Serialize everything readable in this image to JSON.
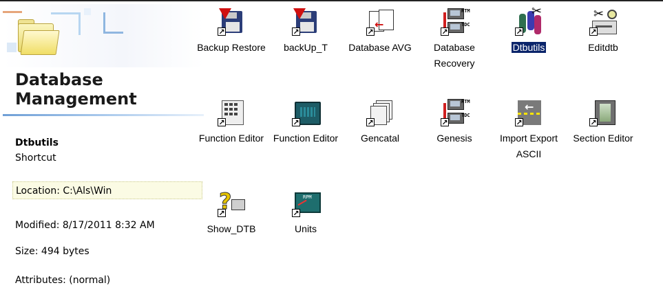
{
  "details_pane": {
    "title": "Database Management",
    "selected": {
      "name": "Dtbutils",
      "type": "Shortcut",
      "location": "Location: C:\\Als\\Win",
      "modified": "Modified: 8/17/2011 8:32 AM",
      "size": "Size: 494 bytes",
      "attributes": "Attributes: (normal)"
    }
  },
  "icons": [
    {
      "label": "Backup Restore",
      "icon": "floppy-restore-icon",
      "shortcut": true
    },
    {
      "label": "backUp_T",
      "icon": "floppy-backup-icon",
      "shortcut": true
    },
    {
      "label": "Database AVG",
      "icon": "document-transfer-icon",
      "shortcut": true
    },
    {
      "label": "Database Recovery",
      "icon": "rtm-tdc-monitors-icon",
      "shortcut": true
    },
    {
      "label": "Dtbutils",
      "icon": "dtbutils-figures-icon",
      "shortcut": true,
      "selected": true
    },
    {
      "label": "Editdtb",
      "icon": "scissors-edit-icon",
      "shortcut": true
    },
    {
      "label": "Function Editor",
      "icon": "calculator-keypad-icon",
      "shortcut": true
    },
    {
      "label": "Function Editor",
      "icon": "terminal-keypad-icon",
      "shortcut": true
    },
    {
      "label": "Gencatal",
      "icon": "document-stack-icon",
      "shortcut": true
    },
    {
      "label": "Genesis",
      "icon": "rtm-tdc-monitors-icon",
      "shortcut": true
    },
    {
      "label": "Import Export ASCII",
      "icon": "import-export-arrow-icon",
      "shortcut": true
    },
    {
      "label": "Section Editor",
      "icon": "section-film-icon",
      "shortcut": true
    },
    {
      "label": "Show_DTB",
      "icon": "question-printer-icon",
      "shortcut": true
    },
    {
      "label": "Units",
      "icon": "rpm-units-icon",
      "shortcut": true
    }
  ],
  "colors": {
    "selection_bg": "#0a246a",
    "selection_text": "#ffffff",
    "location_bg": "#fbfbe4",
    "title_rule": "#6f9fd6"
  }
}
